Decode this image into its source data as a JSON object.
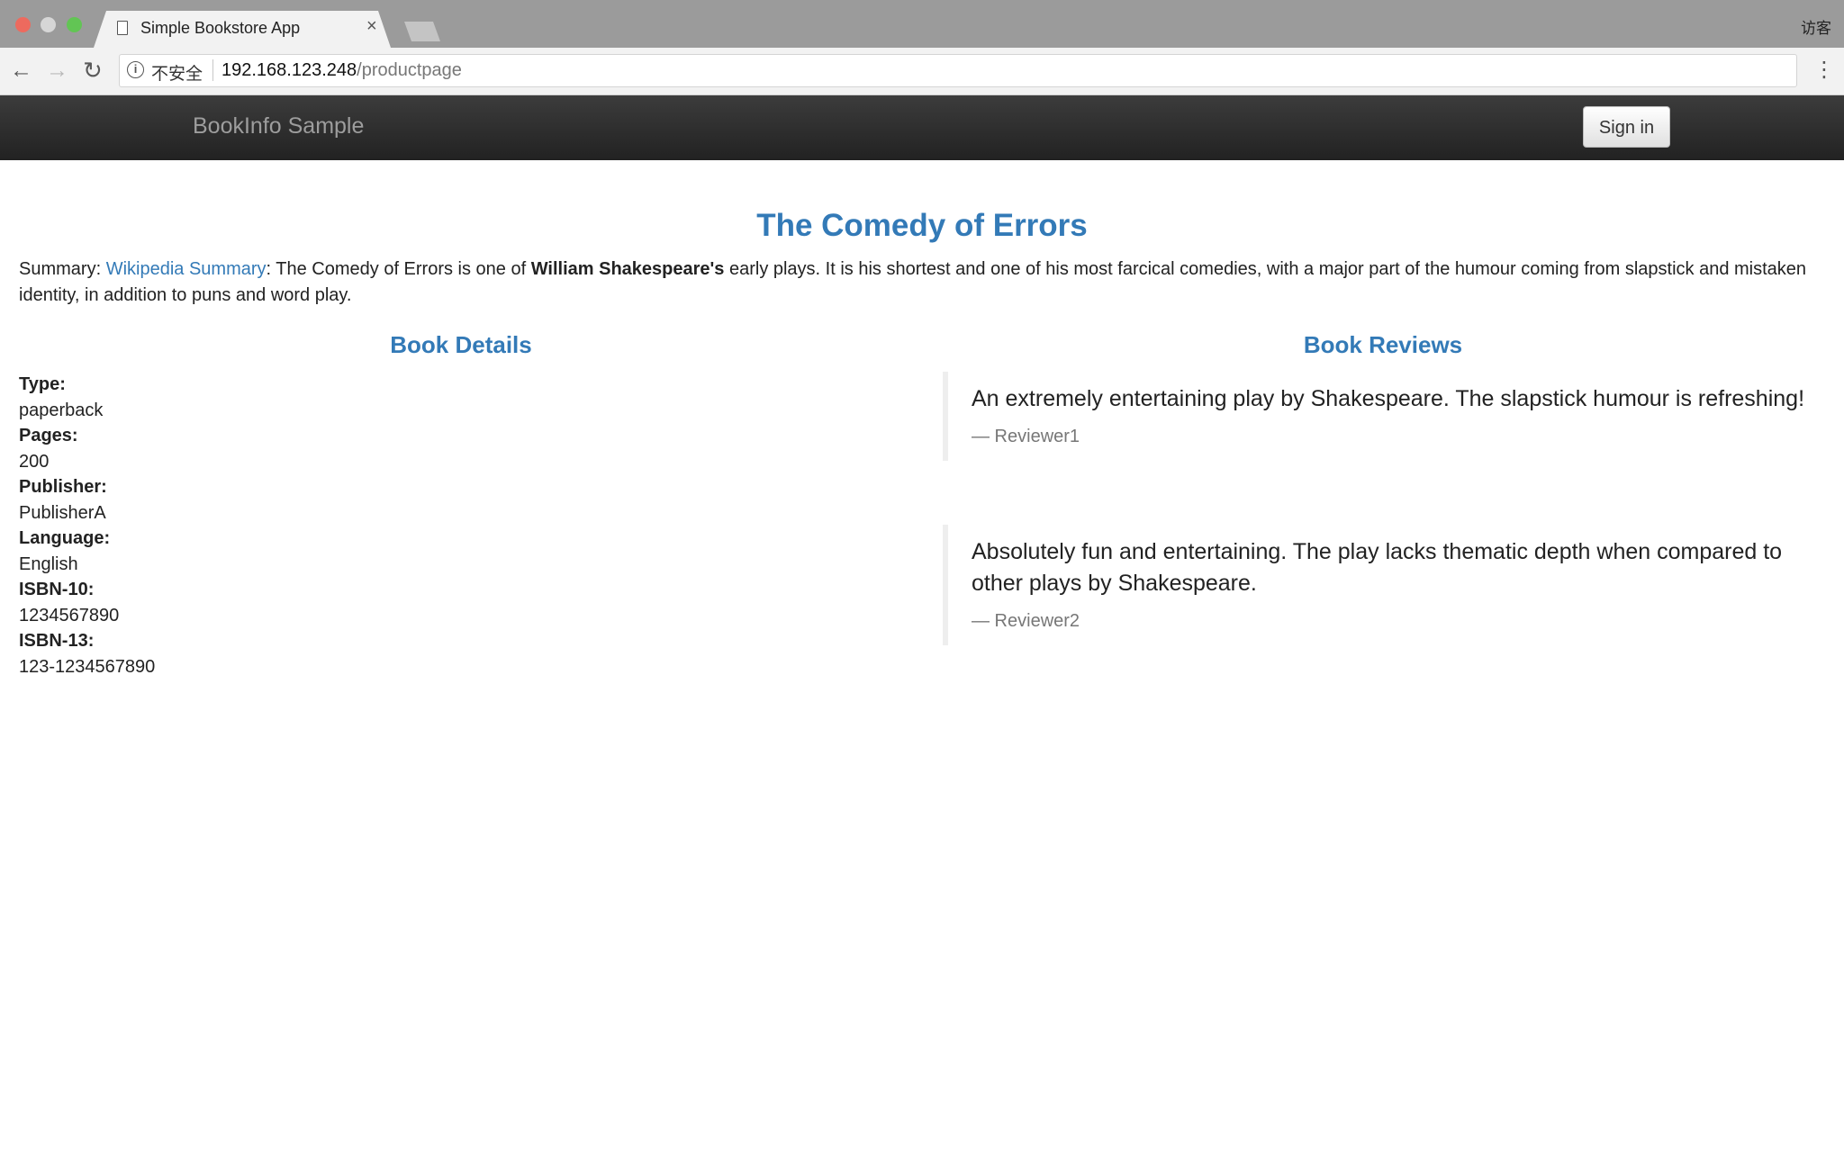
{
  "browser": {
    "tab_title": "Simple Bookstore App",
    "tab_close": "×",
    "guest_label": "访客",
    "back_glyph": "←",
    "forward_glyph": "→",
    "reload_glyph": "↻",
    "menu_glyph": "⋮",
    "info_glyph": "i",
    "security_label": "不安全",
    "url_host": "192.168.123.248",
    "url_path": "/productpage"
  },
  "navbar": {
    "brand": "BookInfo Sample",
    "sign_in_label": "Sign in"
  },
  "product": {
    "title": "The Comedy of Errors",
    "summary_label": "Summary: ",
    "summary_link": "Wikipedia Summary",
    "summary_text_1": ": The Comedy of Errors is one of ",
    "summary_bold": "William Shakespeare's",
    "summary_text_2": " early plays. It is his shortest and one of his most farcical comedies, with a major part of the humour coming from slapstick and mistaken identity, in addition to puns and word play."
  },
  "details": {
    "heading": "Book Details",
    "items": [
      {
        "label": "Type:",
        "value": "paperback"
      },
      {
        "label": "Pages:",
        "value": "200"
      },
      {
        "label": "Publisher:",
        "value": "PublisherA"
      },
      {
        "label": "Language:",
        "value": "English"
      },
      {
        "label": "ISBN-10:",
        "value": "1234567890"
      },
      {
        "label": "ISBN-13:",
        "value": "123-1234567890"
      }
    ]
  },
  "reviews": {
    "heading": "Book Reviews",
    "items": [
      {
        "text": "An extremely entertaining play by Shakespeare. The slapstick humour is refreshing!",
        "reviewer": "— Reviewer1"
      },
      {
        "text": "Absolutely fun and entertaining. The play lacks thematic depth when compared to other plays by Shakespeare.",
        "reviewer": "— Reviewer2"
      }
    ]
  },
  "colors": {
    "accent": "#337ab7",
    "navbar": "#222222",
    "muted": "#777777"
  }
}
